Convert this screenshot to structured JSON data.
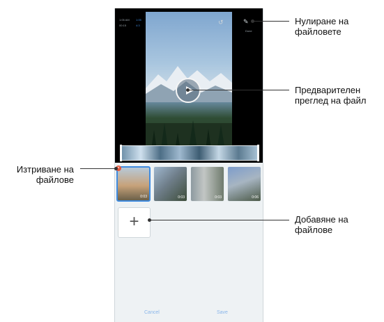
{
  "preview": {
    "tiny_left_1": "1:05 AM",
    "tiny_left_2": "00:15",
    "tiny_blue_1": "1:05",
    "tiny_blue_2": "4:3",
    "tiny_right": "Done"
  },
  "thumbnails": [
    {
      "duration": "0:03"
    },
    {
      "duration": "0:03"
    },
    {
      "duration": "0:03"
    },
    {
      "duration": "0:06"
    }
  ],
  "bottom": {
    "cancel_label": "Cancel",
    "save_label": "Save"
  },
  "callouts": {
    "reset": [
      "Нулиране на",
      "файловете"
    ],
    "preview": [
      "Предварителен",
      "преглед на файл"
    ],
    "delete": [
      "Изтриване на",
      "файлове"
    ],
    "add": [
      "Добавяне на",
      "файлове"
    ]
  },
  "colors": {
    "accent": "#3f8be0",
    "delete_badge": "#e5553b"
  }
}
